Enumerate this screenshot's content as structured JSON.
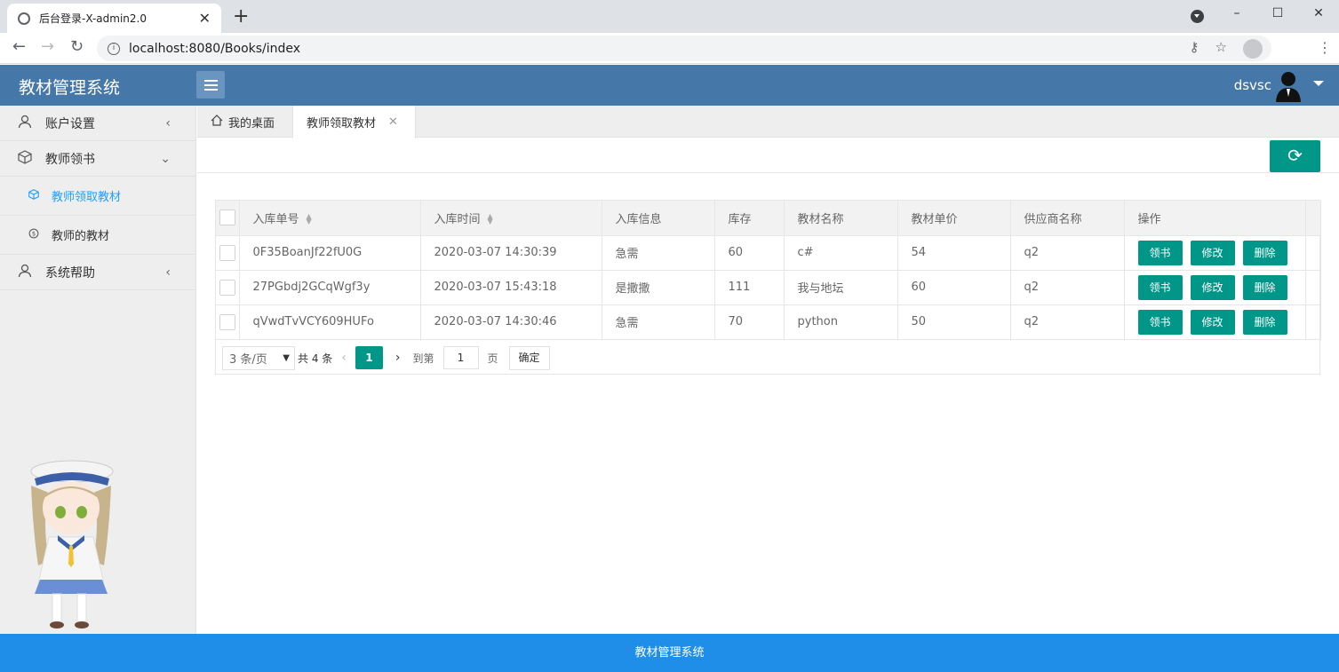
{
  "browser": {
    "tab_title": "后台登录-X-admin2.0",
    "url": "localhost:8080/Books/index",
    "window_controls": [
      "–",
      "☐",
      "✕"
    ]
  },
  "header": {
    "logo": "教材管理系统",
    "username": "dsvsc"
  },
  "sidebar": {
    "items": [
      {
        "label": "账户设置",
        "icon": "user-icon",
        "arrow": "‹"
      },
      {
        "label": "教师领书",
        "icon": "box-icon",
        "arrow": "⌄"
      },
      {
        "label": "系统帮助",
        "icon": "user-icon",
        "arrow": "‹"
      }
    ],
    "subitems": [
      {
        "label": "教师领取教材",
        "icon": "cube-icon",
        "active": true
      },
      {
        "label": "教师的教材",
        "icon": "coin-icon",
        "active": false
      }
    ]
  },
  "tabs": [
    {
      "label": "我的桌面",
      "icon": "home-icon"
    },
    {
      "label": "教师领取教材",
      "closable": true
    }
  ],
  "table": {
    "headers": [
      "入库单号",
      "入库时间",
      "入库信息",
      "库存",
      "教材名称",
      "教材单价",
      "供应商名称",
      "操作"
    ],
    "rows": [
      {
        "id": "0F35BoanJf22fU0G",
        "time": "2020-03-07 14:30:39",
        "info": "急需",
        "stock": "60",
        "name": "c#",
        "price": "54",
        "supplier": "q2"
      },
      {
        "id": "27PGbdj2GCqWgf3y",
        "time": "2020-03-07 15:43:18",
        "info": "是撒撒",
        "stock": "111",
        "name": "我与地坛",
        "price": "60",
        "supplier": "q2"
      },
      {
        "id": "qVwdTvVCY609HUFo",
        "time": "2020-03-07 14:30:46",
        "info": "急需",
        "stock": "70",
        "name": "python",
        "price": "50",
        "supplier": "q2"
      }
    ],
    "actions": [
      "领书",
      "修改",
      "删除"
    ]
  },
  "pager": {
    "page_size": "3 条/页",
    "total": "共 4 条",
    "current": "1",
    "goto_label": "到第",
    "goto_value": "1",
    "page_unit": "页",
    "confirm": "确定"
  },
  "footer": "教材管理系统",
  "colors": {
    "header": "#4577a8",
    "accent": "#009688",
    "footer": "#1e8ee8",
    "active_link": "#1e9fff"
  }
}
